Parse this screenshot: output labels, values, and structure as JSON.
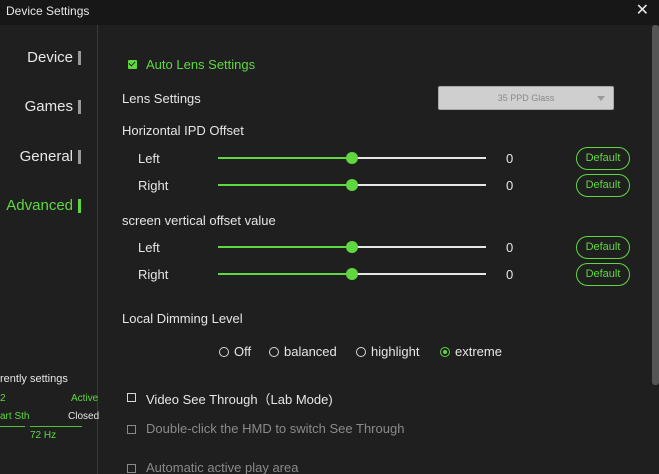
{
  "window": {
    "title": "Device Settings",
    "close_glyph": "✕"
  },
  "sidebar": {
    "items": [
      {
        "label": "Device",
        "active": false
      },
      {
        "label": "Games",
        "active": false
      },
      {
        "label": "General",
        "active": false
      },
      {
        "label": "Advanced",
        "active": true
      }
    ]
  },
  "current_settings": {
    "title": "rently settings",
    "row1_left": "2",
    "row1_right": "Active",
    "row2_left": "art Sth",
    "row2_right": "Closed",
    "refresh": "72 Hz"
  },
  "lens": {
    "auto_label": "Auto Lens Settings",
    "auto_checked": true,
    "settings_label": "Lens Settings",
    "selected": "35 PPD Glass"
  },
  "ipd": {
    "title": "Horizontal IPD Offset",
    "left": {
      "label": "Left",
      "value": "0",
      "position": 0.5,
      "reset_label": "Default"
    },
    "right": {
      "label": "Right",
      "value": "0",
      "position": 0.5,
      "reset_label": "Default"
    }
  },
  "vertical": {
    "title": "screen vertical offset value",
    "left": {
      "label": "Left",
      "value": "0",
      "position": 0.5,
      "reset_label": "Default"
    },
    "right": {
      "label": "Right",
      "value": "0",
      "position": 0.5,
      "reset_label": "Default"
    }
  },
  "dimming": {
    "title": "Local Dimming Level",
    "options": [
      "Off",
      "balanced",
      "highlight",
      "extreme"
    ],
    "selected": "extreme"
  },
  "see_through": {
    "lab_mode_label": "Video See Through（Lab Mode)",
    "lab_mode_checked": false,
    "double_click_label": "Double-click the HMD to switch See Through",
    "double_click_checked": false,
    "play_area_label": "Automatic active play area",
    "play_area_checked": false
  },
  "colors": {
    "accent": "#5fd840",
    "background": "#1f1f1f",
    "titlebar": "#171717"
  }
}
